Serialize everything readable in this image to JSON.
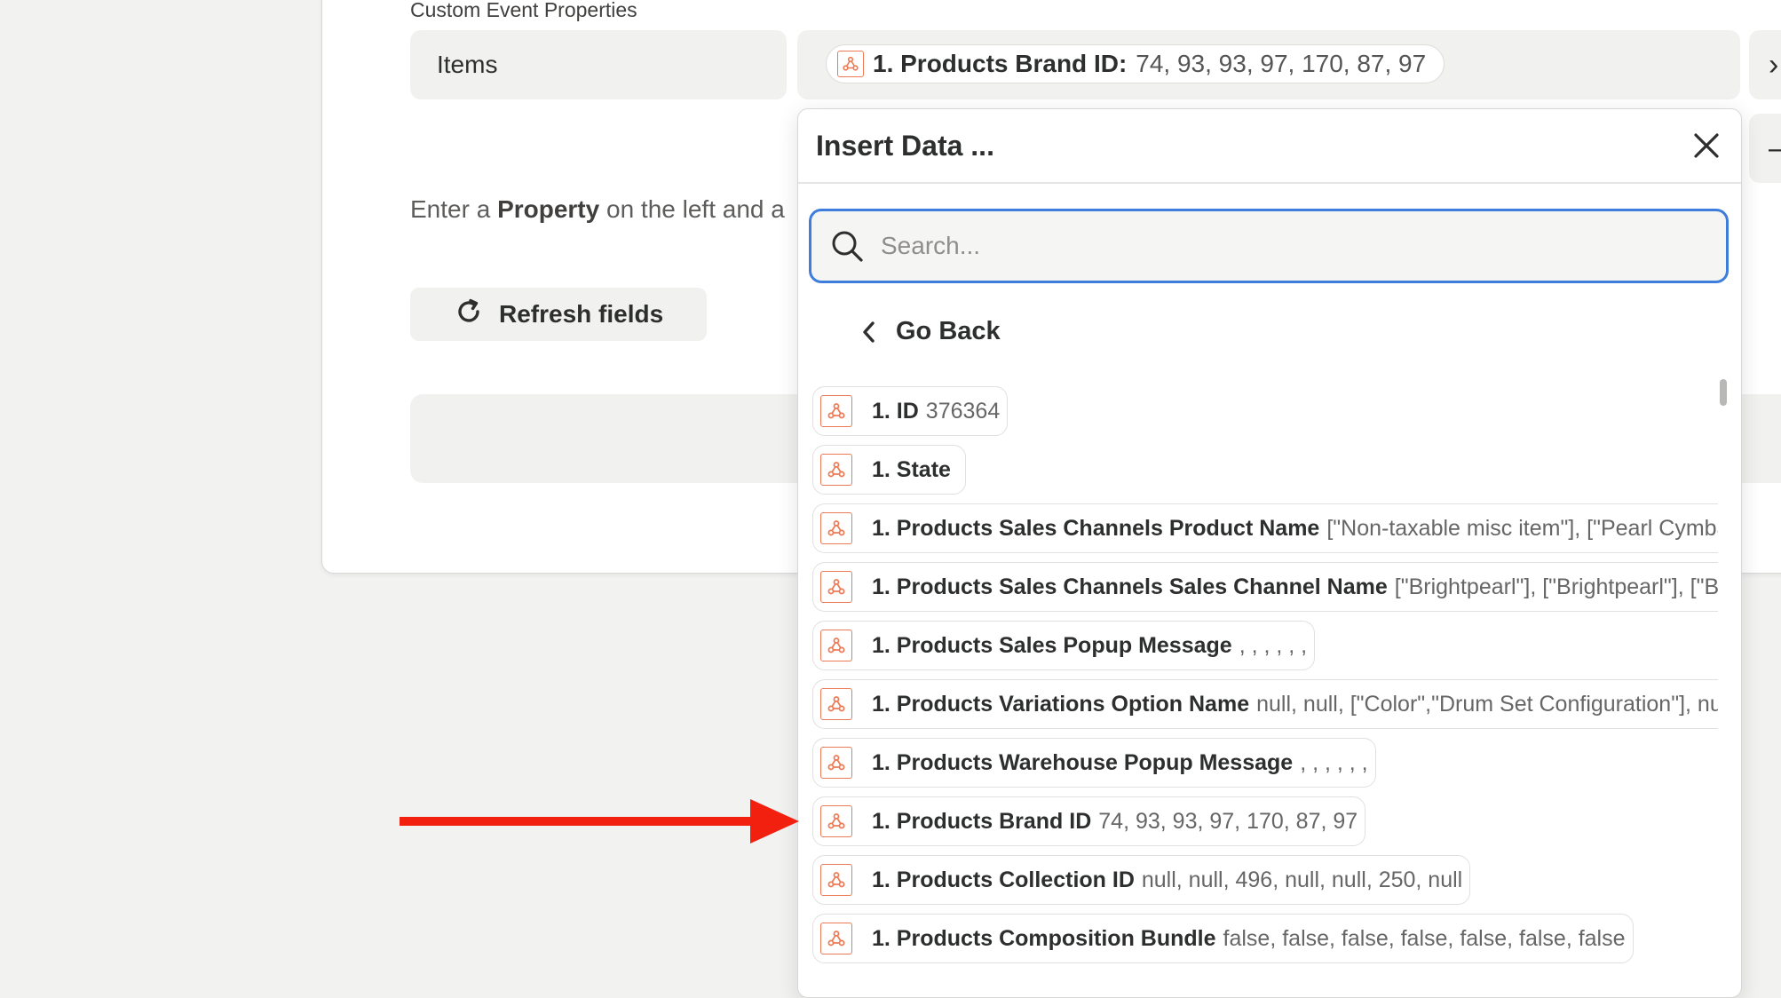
{
  "form": {
    "section_title": "Custom Event Properties",
    "field_label": "Items",
    "value_pill": {
      "label": "1. Products Brand ID:",
      "value": "74, 93, 93, 97, 170, 87, 97"
    },
    "help": {
      "prefix": "Enter a ",
      "bold": "Property",
      "suffix": " on the left and a"
    },
    "refresh_label": "Refresh fields",
    "side_buttons": [
      "›",
      "–"
    ]
  },
  "panel": {
    "title": "Insert Data ...",
    "search_placeholder": "Search...",
    "go_back": "Go Back",
    "items": [
      {
        "label": "1. ID",
        "value": "376364"
      },
      {
        "label": "1. State",
        "value": ""
      },
      {
        "label": "1. Products Sales Channels Product Name",
        "value": "[\"Non-taxable misc item\"], [\"Pearl Cymbal"
      },
      {
        "label": "1. Products Sales Channels Sales Channel Name",
        "value": "[\"Brightpearl\"], [\"Brightpearl\"], [\"Brig"
      },
      {
        "label": "1. Products Sales Popup Message",
        "value": ", , , , , ,"
      },
      {
        "label": "1. Products Variations Option Name",
        "value": "null, null, [\"Color\",\"Drum Set Configuration\"], nu"
      },
      {
        "label": "1. Products Warehouse Popup Message",
        "value": ", , , , , ,"
      },
      {
        "label": "1. Products Brand ID",
        "value": "74, 93, 93, 97, 170, 87, 97"
      },
      {
        "label": "1. Products Collection ID",
        "value": "null, null, 496, null, null, 250, null"
      },
      {
        "label": "1. Products Composition Bundle",
        "value": "false, false, false, false, false, false, false"
      }
    ]
  },
  "colors": {
    "accent": "#3f7ddc",
    "app_icon": "#ee7a55",
    "arrow": "#f2200f"
  },
  "icons": [
    "app-icon",
    "close-icon",
    "search-icon",
    "chevron-left-icon",
    "refresh-icon",
    "arrow-annotation"
  ]
}
